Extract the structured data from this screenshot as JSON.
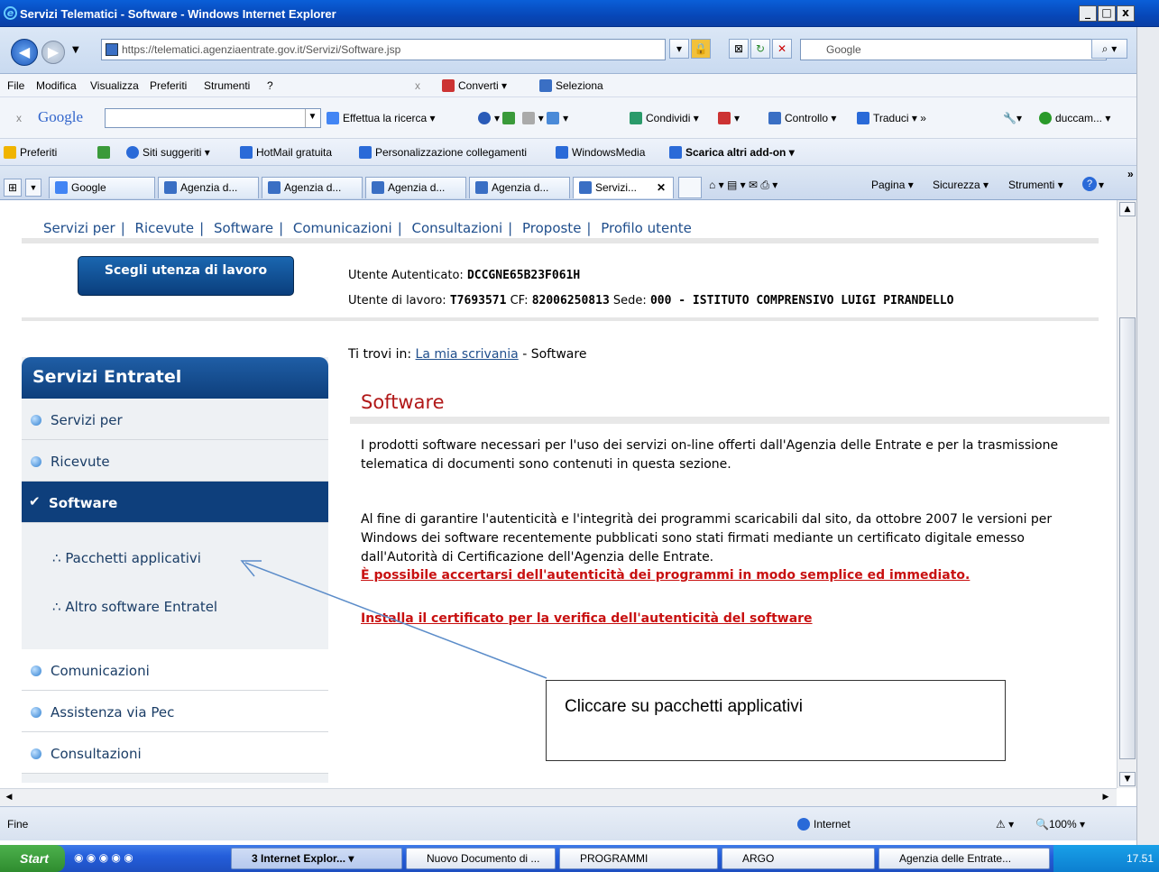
{
  "window": {
    "title": "Servizi Telematici - Software - Windows Internet Explorer"
  },
  "address": {
    "url": "https://telematici.agenziaentrate.gov.it/Servizi/Software.jsp",
    "search_placeholder": "Google"
  },
  "menu": {
    "items": [
      "File",
      "Modifica",
      "Visualizza",
      "Preferiti",
      "Strumenti",
      "?"
    ],
    "converti": "Converti",
    "seleziona": "Seleziona"
  },
  "google_toolbar": {
    "brand": "Google",
    "search": "Effettua la ricerca",
    "condividi": "Condividi",
    "controllo": "Controllo",
    "traduci": "Traduci",
    "user": "duccam..."
  },
  "favorites": {
    "label": "Preferiti",
    "items": [
      "Siti suggeriti",
      "HotMail gratuita",
      "Personalizzazione collegamenti",
      "WindowsMedia",
      "Scarica altri add-on"
    ]
  },
  "tabs": [
    "Google",
    "Agenzia d...",
    "Agenzia d...",
    "Agenzia d...",
    "Agenzia d...",
    "Servizi..."
  ],
  "command_bar": {
    "pagina": "Pagina",
    "sicurezza": "Sicurezza",
    "strumenti": "Strumenti"
  },
  "page": {
    "nav": [
      "Servizi per",
      "Ricevute",
      "Software",
      "Comunicazioni",
      "Consultazioni",
      "Proposte",
      "Profilo utente"
    ],
    "scegli_button": "Scegli utenza di lavoro",
    "user1_label": "Utente Autenticato:",
    "user1_value": "DCCGNE65B23F061H",
    "user2_label": "Utente di lavoro:",
    "user2_value": "T7693571",
    "cf_label": "CF:",
    "cf_value": "82006250813",
    "sede_label": "Sede:",
    "sede_value": "000 - ISTITUTO COMPRENSIVO LUIGI PIRANDELLO",
    "breadcrumb_prefix": "Ti trovi in:",
    "breadcrumb_link": "La mia scrivania",
    "breadcrumb_current": "- Software",
    "title": "Software",
    "para1": "I prodotti software necessari per l'uso dei servizi on-line offerti dall'Agenzia delle Entrate e per la trasmissione telematica di documenti sono contenuti in questa sezione.",
    "para2": "Al fine di garantire l'autenticità e l'integrità dei programmi scaricabili dal sito, da ottobre 2007 le versioni per Windows dei software recentemente pubblicati sono stati firmati mediante un certificato digitale emesso dall'Autorità di Certificazione dell'Agenzia delle Entrate.",
    "link1": "È possibile accertarsi dell'autenticità dei programmi in modo semplice ed immediato.",
    "link2": "Installa il certificato per la verifica dell'autenticità del software"
  },
  "sidebar": {
    "title": "Servizi Entratel",
    "items": [
      "Servizi per",
      "Ricevute",
      "Software",
      "Comunicazioni",
      "Assistenza via Pec",
      "Consultazioni"
    ],
    "subitems": [
      "Pacchetti applicativi",
      "Altro software Entratel"
    ]
  },
  "annotation": "Cliccare su pacchetti applicativi",
  "status": {
    "left": "Fine",
    "zone": "Internet",
    "zoom": "100%"
  },
  "taskbar": {
    "start": "Start",
    "items": [
      "3 Internet Explor...",
      "Nuovo Documento di ...",
      "PROGRAMMI",
      "ARGO",
      "Agenzia delle Entrate..."
    ],
    "clock": "17.51"
  }
}
